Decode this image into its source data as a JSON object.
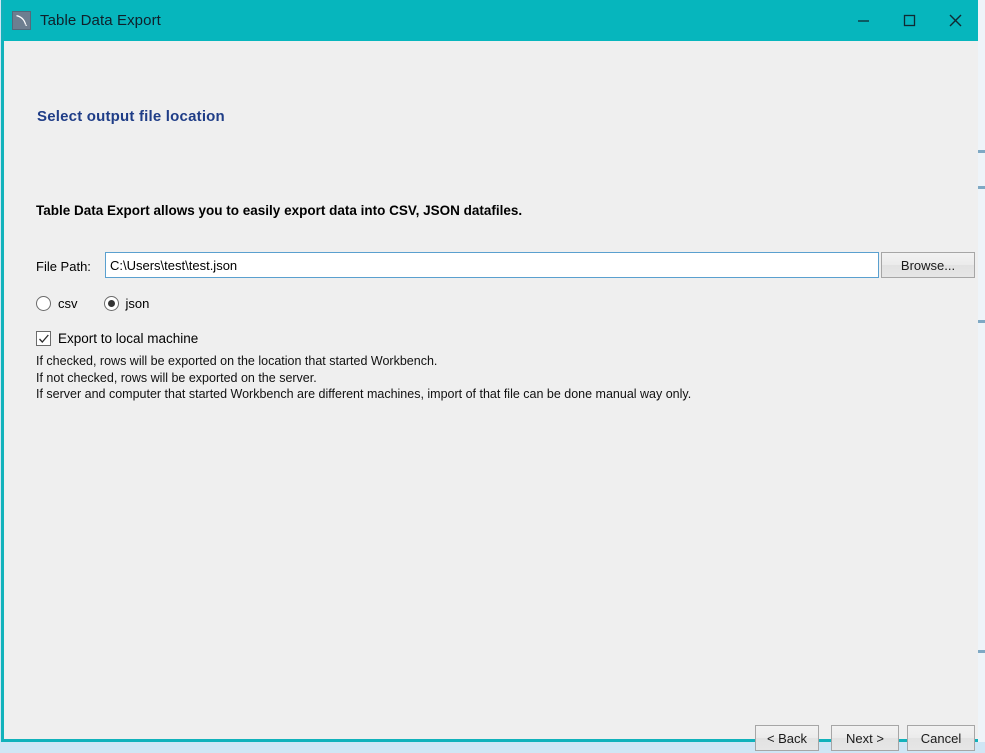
{
  "window": {
    "title": "Table Data Export",
    "icon": "mysql-workbench-dolphin-icon",
    "titlebar_color": "#06b6bd",
    "border_color": "#11b2bb",
    "background_color": "#efefef",
    "controls": {
      "minimize": "–",
      "maximize": "☐",
      "close": "✕"
    }
  },
  "page": {
    "heading": "Select output file location",
    "heading_color": "#1f3d87",
    "intro": "Table Data Export allows you to easily export data into CSV, JSON datafiles."
  },
  "form": {
    "file_path": {
      "label": "File Path:",
      "value": "C:\\Users\\test\\test.json",
      "placeholder": ""
    },
    "browse_label": "Browse...",
    "format": {
      "selected": "json",
      "options": [
        {
          "id": "csv",
          "label": "csv",
          "selected": false
        },
        {
          "id": "json",
          "label": "json",
          "selected": true
        }
      ]
    },
    "export_local": {
      "label": "Export to local machine",
      "checked": true,
      "checkmark": "✓"
    },
    "help": {
      "line1": "If checked, rows will be exported on the location that started Workbench.",
      "line2": "If not checked, rows will be exported on the server.",
      "line3": "If server and computer that started Workbench are different machines, import of that file can be done manual way only."
    }
  },
  "footer": {
    "back_label": "< Back",
    "next_label": "Next >",
    "cancel_label": "Cancel"
  }
}
